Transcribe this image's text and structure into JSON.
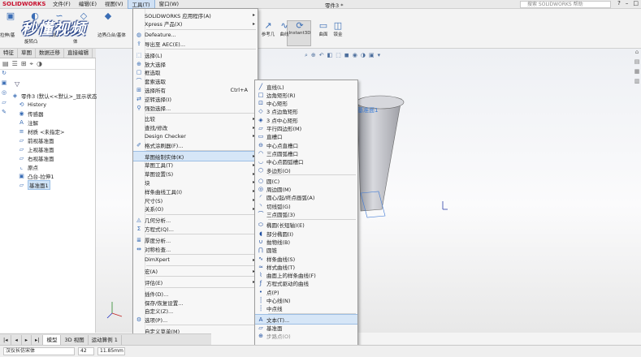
{
  "app": {
    "logo": "SOLIDWORKS",
    "doc_title": "零件3 *",
    "search_placeholder": "搜索 SOLIDWORKS 帮助"
  },
  "menubar": {
    "items": [
      "文件(F)",
      "编辑(E)",
      "视图(V)",
      "工具(T)",
      "窗口(W)"
    ],
    "active_index": 3
  },
  "watermark": "秒懂视频",
  "ribbon": {
    "left_labels": [
      "拉伸/基",
      "旋转凸",
      "扫描",
      "体",
      "边界凸台/基体"
    ],
    "right_buttons": [
      {
        "icon": "line-icon",
        "glyph": "↗",
        "label": "参考几"
      },
      {
        "icon": "curve-icon",
        "glyph": "∿",
        "label": "曲线"
      },
      {
        "icon": "instant3d-icon",
        "glyph": "⟳",
        "label": "Instant3D"
      },
      {
        "icon": "planes-icon",
        "glyph": "▭",
        "label": "曲面"
      },
      {
        "icon": "shell-icon",
        "glyph": "◫",
        "label": "钣金"
      }
    ]
  },
  "cmd_tabs": [
    "特征",
    "草图",
    "数据迁移",
    "直接编辑",
    "评估",
    "DimXpert"
  ],
  "feature_tree": {
    "filter_icon": "filter-icon",
    "items": [
      {
        "label": "零件3 (默认<<默认>_显示状态",
        "icon": "part-icon",
        "indent": 0,
        "selected": false
      },
      {
        "label": "History",
        "icon": "history-icon",
        "indent": 1,
        "selected": false
      },
      {
        "label": "传感器",
        "icon": "sensor-icon",
        "indent": 1,
        "selected": false
      },
      {
        "label": "注解",
        "icon": "annotation-icon",
        "indent": 1,
        "selected": false
      },
      {
        "label": "材质 <未指定>",
        "icon": "material-icon",
        "indent": 1,
        "selected": false
      },
      {
        "label": "前视基准面",
        "icon": "plane-icon",
        "indent": 1,
        "selected": false
      },
      {
        "label": "上视基准面",
        "icon": "plane-icon",
        "indent": 1,
        "selected": false
      },
      {
        "label": "右视基准面",
        "icon": "plane-icon",
        "indent": 1,
        "selected": false
      },
      {
        "label": "原点",
        "icon": "origin-icon",
        "indent": 1,
        "selected": false
      },
      {
        "label": "凸台-拉伸1",
        "icon": "extrude-icon",
        "indent": 1,
        "selected": false
      },
      {
        "label": "基准面1",
        "icon": "plane-icon",
        "indent": 1,
        "selected": true
      }
    ]
  },
  "tools_menu": {
    "items": [
      {
        "label": "SOLIDWORKS 应用程序(A)",
        "icon": "",
        "arrow": true,
        "shortcut": ""
      },
      {
        "label": "Xpress 产品(X)",
        "icon": "",
        "arrow": true,
        "shortcut": ""
      },
      {
        "sep": true
      },
      {
        "label": "Defeature...",
        "icon": "defeature-icon",
        "arrow": false,
        "shortcut": ""
      },
      {
        "label": "导出至 AEC(E)...",
        "icon": "export-icon",
        "arrow": false,
        "shortcut": ""
      },
      {
        "sep": true
      },
      {
        "label": "选择(L)",
        "icon": "select-icon",
        "arrow": false,
        "shortcut": ""
      },
      {
        "label": "放大选择",
        "icon": "magnify-icon",
        "arrow": false,
        "shortcut": ""
      },
      {
        "label": "框选取",
        "icon": "box-select-icon",
        "arrow": false,
        "shortcut": ""
      },
      {
        "label": "套索选取",
        "icon": "lasso-icon",
        "arrow": false,
        "shortcut": ""
      },
      {
        "label": "选择所有",
        "icon": "select-all-icon",
        "arrow": false,
        "shortcut": "Ctrl+A"
      },
      {
        "label": "逆转选择(I)",
        "icon": "invert-icon",
        "arrow": false,
        "shortcut": ""
      },
      {
        "label": "强劲选择...",
        "icon": "power-select-icon",
        "arrow": false,
        "shortcut": ""
      },
      {
        "sep": true
      },
      {
        "label": "比较",
        "icon": "",
        "arrow": true,
        "shortcut": ""
      },
      {
        "label": "查找/修改",
        "icon": "",
        "arrow": true,
        "shortcut": ""
      },
      {
        "label": "Design Checker",
        "icon": "",
        "arrow": true,
        "shortcut": ""
      },
      {
        "label": "格式涂刷器(F)...",
        "icon": "brush-icon",
        "arrow": false,
        "shortcut": ""
      },
      {
        "sep": true
      },
      {
        "label": "草图绘制实体(K)",
        "icon": "",
        "arrow": true,
        "shortcut": "",
        "highlight": true
      },
      {
        "label": "草图工具(T)",
        "icon": "",
        "arrow": true,
        "shortcut": ""
      },
      {
        "label": "草图设置(S)",
        "icon": "",
        "arrow": true,
        "shortcut": ""
      },
      {
        "label": "块",
        "icon": "",
        "arrow": true,
        "shortcut": ""
      },
      {
        "label": "样条曲线工具(I)",
        "icon": "",
        "arrow": true,
        "shortcut": ""
      },
      {
        "label": "尺寸(S)",
        "icon": "",
        "arrow": true,
        "shortcut": ""
      },
      {
        "label": "关系(O)",
        "icon": "",
        "arrow": true,
        "shortcut": ""
      },
      {
        "sep": true
      },
      {
        "label": "几何分析...",
        "icon": "geometry-icon",
        "arrow": false,
        "shortcut": ""
      },
      {
        "label": "方程式(Q)...",
        "icon": "sigma-icon",
        "arrow": false,
        "shortcut": ""
      },
      {
        "sep": true
      },
      {
        "label": "厚度分析...",
        "icon": "thickness-icon",
        "arrow": false,
        "shortcut": ""
      },
      {
        "label": "对称检查...",
        "icon": "symmetry-icon",
        "arrow": false,
        "shortcut": ""
      },
      {
        "sep": true
      },
      {
        "label": "DimXpert",
        "icon": "",
        "arrow": true,
        "shortcut": ""
      },
      {
        "sep": true
      },
      {
        "label": "宏(A)",
        "icon": "",
        "arrow": true,
        "shortcut": ""
      },
      {
        "sep": true
      },
      {
        "label": "评估(E)",
        "icon": "",
        "arrow": true,
        "shortcut": ""
      },
      {
        "sep": true
      },
      {
        "label": "插件(D)...",
        "icon": "",
        "arrow": false,
        "shortcut": ""
      },
      {
        "label": "保存/恢复设置...",
        "icon": "",
        "arrow": false,
        "shortcut": ""
      },
      {
        "label": "自定义(Z)...",
        "icon": "",
        "arrow": false,
        "shortcut": ""
      },
      {
        "label": "选项(P)...",
        "icon": "gear-icon",
        "arrow": false,
        "shortcut": ""
      },
      {
        "sep": true
      },
      {
        "label": "自定义菜单(M)",
        "icon": "",
        "arrow": false,
        "shortcut": ""
      }
    ]
  },
  "sketch_submenu": {
    "items": [
      {
        "label": "直线(L)",
        "glyph": "╱",
        "icon": "line-icon"
      },
      {
        "label": "边角矩形(R)",
        "glyph": "□",
        "icon": "rectangle-icon"
      },
      {
        "label": "中心矩形",
        "glyph": "⊡",
        "icon": "center-rectangle-icon"
      },
      {
        "label": "3 点边角矩形",
        "glyph": "◇",
        "icon": "3pt-rectangle-icon"
      },
      {
        "label": "3 点中心矩形",
        "glyph": "◈",
        "icon": "3pt-center-rectangle-icon"
      },
      {
        "label": "平行四边形(M)",
        "glyph": "▱",
        "icon": "parallelogram-icon"
      },
      {
        "label": "直槽口",
        "glyph": "▭",
        "icon": "slot-icon"
      },
      {
        "label": "中心点直槽口",
        "glyph": "⊖",
        "icon": "center-slot-icon"
      },
      {
        "label": "三点圆弧槽口",
        "glyph": "◠",
        "icon": "arc-slot-icon"
      },
      {
        "label": "中心点圆弧槽口",
        "glyph": "◡",
        "icon": "center-arc-slot-icon"
      },
      {
        "label": "多边形(O)",
        "glyph": "⬡",
        "icon": "polygon-icon"
      },
      {
        "sep": true
      },
      {
        "label": "圆(C)",
        "glyph": "○",
        "icon": "circle-icon"
      },
      {
        "label": "周边圆(M)",
        "glyph": "◎",
        "icon": "perimeter-circle-icon"
      },
      {
        "label": "圆心/起/终点画弧(A)",
        "glyph": "◜",
        "icon": "center-arc-icon"
      },
      {
        "label": "切线弧(G)",
        "glyph": "◝",
        "icon": "tangent-arc-icon"
      },
      {
        "label": "三点圆弧(3)",
        "glyph": "⌒",
        "icon": "3pt-arc-icon"
      },
      {
        "sep": true
      },
      {
        "label": "椭圆(长短轴)(E)",
        "glyph": "⬭",
        "icon": "ellipse-icon"
      },
      {
        "label": "部分椭圆(I)",
        "glyph": "◖",
        "icon": "partial-ellipse-icon"
      },
      {
        "label": "抛物线(B)",
        "glyph": "∪",
        "icon": "parabola-icon"
      },
      {
        "label": "圆锥",
        "glyph": "⋂",
        "icon": "conic-icon"
      },
      {
        "label": "样条曲线(S)",
        "glyph": "∿",
        "icon": "spline-icon"
      },
      {
        "label": "样式曲线(T)",
        "glyph": "≈",
        "icon": "style-spline-icon"
      },
      {
        "label": "曲面上的样条曲线(F)",
        "glyph": "⌇",
        "icon": "surface-spline-icon"
      },
      {
        "label": "方程式驱动的曲线",
        "glyph": "ƒ",
        "icon": "equation-curve-icon"
      },
      {
        "label": "点(P)",
        "glyph": "•",
        "icon": "point-icon"
      },
      {
        "label": "中心线(N)",
        "glyph": "┆",
        "icon": "centerline-icon"
      },
      {
        "label": "中点线",
        "glyph": "┊",
        "icon": "midpoint-line-icon"
      },
      {
        "sep": true
      },
      {
        "label": "文本(T)...",
        "glyph": "A",
        "icon": "text-icon",
        "highlight": true
      },
      {
        "label": "基准面",
        "glyph": "▱",
        "icon": "plane-icon"
      },
      {
        "label": "步路点(O)",
        "glyph": "⊕",
        "icon": "route-point-icon",
        "dim": true
      }
    ]
  },
  "part_label": "基准面1",
  "bottom_tabs": [
    "模型",
    "3D 视图",
    "运动算例 1"
  ],
  "status": {
    "font": "汉仪长仿宋体",
    "size": "42",
    "height": "11.85mm"
  }
}
